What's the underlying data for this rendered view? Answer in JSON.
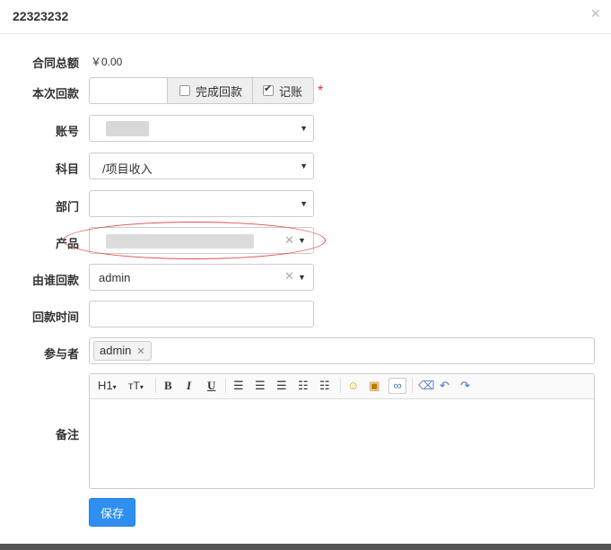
{
  "modal": {
    "title": "22323232",
    "close_icon": "×"
  },
  "form": {
    "contract_total": {
      "label": "合同总额",
      "value": "￥0.00"
    },
    "current_payment": {
      "label": "本次回款",
      "value": "",
      "addon_complete": "完成回款",
      "addon_record": "记账",
      "complete_checked": false,
      "record_checked": true,
      "required_mark": "*"
    },
    "account": {
      "label": "账号",
      "value": ""
    },
    "subject": {
      "label": "科目",
      "value": "/项目收入"
    },
    "department": {
      "label": "部门",
      "value": ""
    },
    "product": {
      "label": "产品",
      "value": ""
    },
    "payer": {
      "label": "由谁回款",
      "value": "admin"
    },
    "payment_time": {
      "label": "回款时间",
      "value": ""
    },
    "participants": {
      "label": "参与者",
      "tags": [
        "admin"
      ]
    },
    "remark": {
      "label": "备注"
    }
  },
  "editor_toolbar": {
    "h1": "H1",
    "font_size": "тT",
    "bold": "B",
    "italic": "I",
    "underline": "U"
  },
  "save_button": "保存",
  "colors": {
    "primary": "#2f8ff1",
    "required": "#d33333",
    "highlight": "#e05050"
  }
}
